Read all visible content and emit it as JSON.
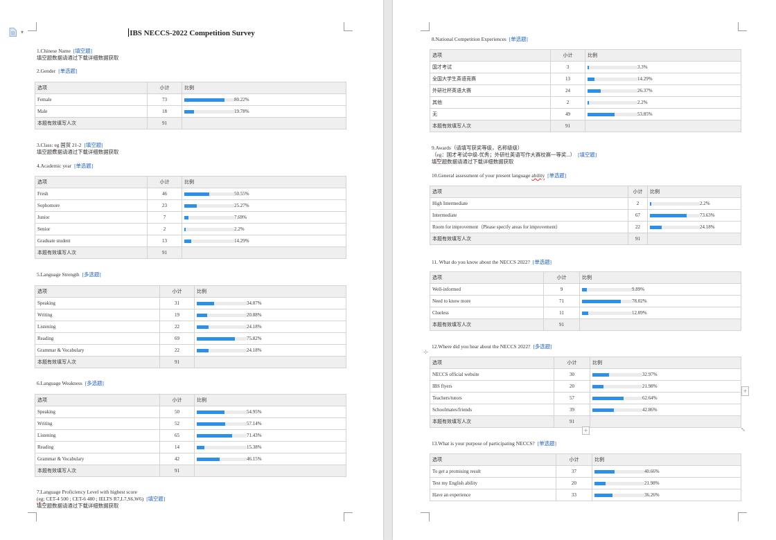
{
  "document": {
    "title": "IBS NECCS-2022 Competition Survey"
  },
  "common": {
    "col_option": "选项",
    "col_count": "小计",
    "col_ratio": "比例",
    "valid_total": "本题有效填写人次",
    "fill_note": "填空题数据请通过下载详细数据获取"
  },
  "left": {
    "q1": {
      "label": "1.Chinese Name",
      "tag": "[填空题]"
    },
    "q2": {
      "label": "2.Gender",
      "tag": "[单选题]",
      "total": "91",
      "rows": [
        {
          "label": "Female",
          "count": "73",
          "pct": "80.22%",
          "value": 80.22
        },
        {
          "label": "Male",
          "count": "18",
          "pct": "19.78%",
          "value": 19.78
        }
      ]
    },
    "q3": {
      "label_a": "3.Class: ",
      "label_b": "eg",
      "label_c": " 国贸 21-2",
      "tag": "[填空题]"
    },
    "q4": {
      "label": "4.Academic year",
      "tag": "[单选题]",
      "total": "91",
      "rows": [
        {
          "label": "Fresh",
          "count": "46",
          "pct": "50.55%",
          "value": 50.55
        },
        {
          "label": "Sophomore",
          "count": "23",
          "pct": "25.27%",
          "value": 25.27
        },
        {
          "label": "Junior",
          "count": "7",
          "pct": "7.69%",
          "value": 7.69
        },
        {
          "label": "Senior",
          "count": "2",
          "pct": "2.2%",
          "value": 2.2
        },
        {
          "label": "Graduate student",
          "count": "13",
          "pct": "14.29%",
          "value": 14.29
        }
      ]
    },
    "q5": {
      "label": "5.Language Strength",
      "tag": "[多选题]",
      "total": "91",
      "rows": [
        {
          "label": "Speaking",
          "count": "31",
          "pct": "34.07%",
          "value": 34.07
        },
        {
          "label": "Writing",
          "count": "19",
          "pct": "20.88%",
          "value": 20.88
        },
        {
          "label": "Listening",
          "count": "22",
          "pct": "24.18%",
          "value": 24.18
        },
        {
          "label": "Reading",
          "count": "69",
          "pct": "75.82%",
          "value": 75.82
        },
        {
          "label": "Grammar & Vocabulary",
          "count": "22",
          "pct": "24.18%",
          "value": 24.18
        }
      ]
    },
    "q6": {
      "label": "6.Language Weakness",
      "tag": "[多选题]",
      "total": "91",
      "rows": [
        {
          "label": "Speaking",
          "count": "50",
          "pct": "54.95%",
          "value": 54.95
        },
        {
          "label": "Writing",
          "count": "52",
          "pct": "57.14%",
          "value": 57.14
        },
        {
          "label": "Listening",
          "count": "65",
          "pct": "71.43%",
          "value": 71.43
        },
        {
          "label": "Reading",
          "count": "14",
          "pct": "15.38%",
          "value": 15.38
        },
        {
          "label": "Grammar & Vocabulary",
          "count": "42",
          "pct": "46.15%",
          "value": 46.15
        }
      ]
    },
    "q7": {
      "label": "7.Language Proficiency Level with highest score",
      "example_a": "(eg:",
      "example_b": " CET-4 500 ; CET-6 480 ; IELTS R7,L7,S6,W6)",
      "tag": "[填空题]"
    }
  },
  "right": {
    "q8": {
      "label": "8.National Competition Experiences",
      "tag": "[单选题]",
      "total": "91",
      "rows": [
        {
          "label": "国才考试",
          "count": "3",
          "pct": "3.3%",
          "value": 3.3
        },
        {
          "label": "全国大学生英语竞赛",
          "count": "13",
          "pct": "14.29%",
          "value": 14.29
        },
        {
          "label": "外研社杯英语大赛",
          "count": "24",
          "pct": "26.37%",
          "value": 26.37
        },
        {
          "label": "其他",
          "count": "2",
          "pct": "2.2%",
          "value": 2.2
        },
        {
          "label": "无",
          "count": "49",
          "pct": "53.85%",
          "value": 53.85
        }
      ]
    },
    "q9": {
      "label": "9.Awards（请填写获奖等级，名称级级）",
      "example_a": "（",
      "example_b": "eg",
      "example_c": "：国才考试中级-优秀；外研社英语写作大赛校赛一等奖...）",
      "tag": "[填空题]"
    },
    "q10": {
      "label_a": "10.General assessment of your present language ",
      "label_b": "ability",
      "tag": "[单选题]",
      "total": "91",
      "rows": [
        {
          "label": "High Intermediate",
          "count": "2",
          "pct": "2.2%",
          "value": 2.2
        },
        {
          "label": "Intermediate",
          "count": "67",
          "pct": "73.63%",
          "value": 73.63
        },
        {
          "label": "Room for improvement（Please specify areas for improvement）",
          "count": "22",
          "pct": "24.18%",
          "value": 24.18
        }
      ]
    },
    "q11": {
      "label": "11. What do you know about the NECCS 2022?",
      "tag": "[单选题]",
      "total": "91",
      "rows": [
        {
          "label": "Well-informed",
          "count": "9",
          "pct": "9.89%",
          "value": 9.89
        },
        {
          "label": "Need to know more",
          "count": "71",
          "pct": "78.02%",
          "value": 78.02
        },
        {
          "label": "Clueless",
          "count": "11",
          "pct": "12.09%",
          "value": 12.09
        }
      ]
    },
    "q12": {
      "label": "12.Where did you hear about the NECCS 2022?",
      "tag": "[多选题]",
      "total": "91",
      "rows": [
        {
          "label": "NECCS official website",
          "count": "30",
          "pct": "32.97%",
          "value": 32.97
        },
        {
          "label": "IBS flyers",
          "count": "20",
          "pct": "21.98%",
          "value": 21.98
        },
        {
          "label": "Teachers/tutors",
          "count": "57",
          "pct": "62.64%",
          "value": 62.64
        },
        {
          "label": "Schoolmates/friends",
          "count": "39",
          "pct": "42.86%",
          "value": 42.86
        }
      ]
    },
    "q13": {
      "label": "13.What is your purpose of participating NECCS?",
      "tag": "[单选题]",
      "rows": [
        {
          "label": "To get a promising result",
          "count": "37",
          "pct": "40.66%",
          "value": 40.66
        },
        {
          "label": "Test my English ability",
          "count": "20",
          "pct": "21.98%",
          "value": 21.98
        },
        {
          "label": "Have an experience",
          "count": "33",
          "pct": "36.26%",
          "value": 36.26
        }
      ]
    }
  }
}
